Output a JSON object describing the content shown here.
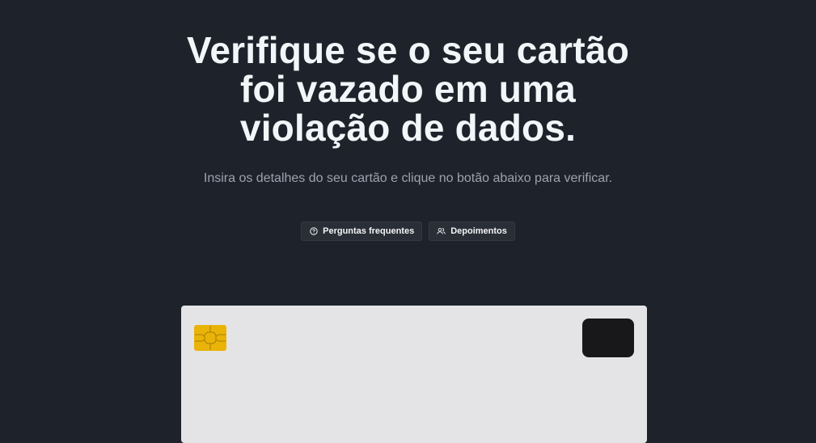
{
  "hero": {
    "title": "Verifique se o seu cartão\nfoi vazado em uma\nviolação de dados.",
    "subtitle": "Insira os detalhes do seu cartão e clique no botão abaixo para verificar."
  },
  "buttons": {
    "faq": {
      "label": "Perguntas frequentes",
      "icon": "question-circle-icon"
    },
    "testimonials": {
      "label": "Depoimentos",
      "icon": "users-icon"
    }
  },
  "card": {
    "chip_icon": "card-chip-icon",
    "colors": {
      "card_background": "#e4e4e7",
      "chip": "#eab308",
      "logo_box": "#18181b"
    }
  },
  "colors": {
    "page_background": "#1e232b",
    "title": "#f3f6f9",
    "subtitle": "#9ca3af",
    "button_background": "#2a2f37"
  }
}
